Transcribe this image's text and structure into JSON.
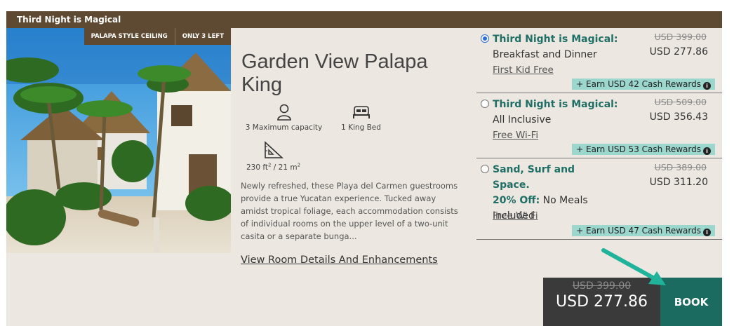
{
  "ribbon": {
    "label": "Third Night is Magical"
  },
  "photo": {
    "tags": [
      "PALAPA STYLE CEILING",
      "ONLY 3 LEFT"
    ]
  },
  "room": {
    "title": "Garden View Palapa King",
    "amenities": {
      "capacity": "3 Maximum capacity",
      "bed": "1 King Bed",
      "size_ft": "230 ft",
      "size_sep": " / 21 m",
      "sup": "2"
    },
    "description": "Newly refreshed, these Playa del Carmen guestrooms provide a true Yucatan experience. Tucked away amidst tropical foliage, each accommodation consists of individual rooms on the upper level of a two-unit casita or a separate bunga...",
    "details_link": "View Room Details And Enhancements"
  },
  "rates": [
    {
      "title": "Third Night is Magical:",
      "subtitle": "Breakfast and Dinner",
      "old_price": "USD 399.00",
      "price": "USD 277.86",
      "perk": "First Kid Free",
      "rewards": "+ Earn USD 42 Cash Rewards",
      "selected": true
    },
    {
      "title": "Third Night is Magical:",
      "subtitle": "All Inclusive",
      "old_price": "USD 509.00",
      "price": "USD 356.43",
      "perk": "Free Wi-Fi",
      "rewards": "+ Earn USD 53 Cash Rewards",
      "selected": false
    },
    {
      "title": "Sand, Surf and Space.",
      "title2": "20% Off:",
      "subtitle": " No Meals Included",
      "old_price": "USD 389.00",
      "price": "USD 311.20",
      "perk": "Free Wi Fi",
      "rewards": "+ Earn USD 47 Cash Rewards",
      "selected": false
    }
  ],
  "summary": {
    "old_price": "USD 399.00",
    "price": "USD 277.86",
    "book_label": "BOOK"
  },
  "colors": {
    "brown": "#5e4a33",
    "teal": "#1c6b60",
    "rewards": "#9cd7ce",
    "card_bg": "#ece7e0"
  },
  "icons": {
    "info": "i"
  }
}
